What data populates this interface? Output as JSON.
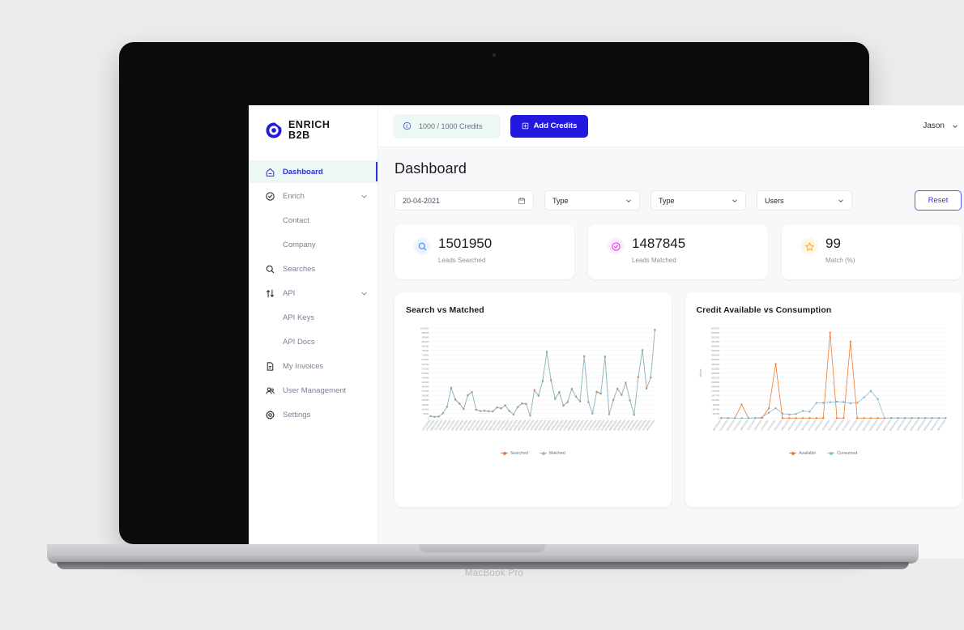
{
  "device": {
    "label": "MacBook Pro"
  },
  "brand": {
    "name_line1": "ENRICH",
    "name_line2": "B2B",
    "color": "#2218df"
  },
  "sidebar": {
    "items": [
      {
        "label": "Dashboard",
        "icon": "home-icon",
        "active": true,
        "has_caret": false,
        "sub": false
      },
      {
        "label": "Enrich",
        "icon": "check-circle-icon",
        "active": false,
        "has_caret": true,
        "sub": false
      },
      {
        "label": "Contact",
        "icon": "none",
        "active": false,
        "has_caret": false,
        "sub": true
      },
      {
        "label": "Company",
        "icon": "none",
        "active": false,
        "has_caret": false,
        "sub": true
      },
      {
        "label": "Searches",
        "icon": "search-icon",
        "active": false,
        "has_caret": false,
        "sub": false
      },
      {
        "label": "API",
        "icon": "transfer-icon",
        "active": false,
        "has_caret": true,
        "sub": false
      },
      {
        "label": "API Keys",
        "icon": "none",
        "active": false,
        "has_caret": false,
        "sub": true
      },
      {
        "label": "API Docs",
        "icon": "none",
        "active": false,
        "has_caret": false,
        "sub": true
      },
      {
        "label": "My Invoices",
        "icon": "invoice-icon",
        "active": false,
        "has_caret": false,
        "sub": false
      },
      {
        "label": "User Management",
        "icon": "users-icon",
        "active": false,
        "has_caret": false,
        "sub": false
      },
      {
        "label": "Settings",
        "icon": "gear-icon",
        "active": false,
        "has_caret": false,
        "sub": false
      }
    ]
  },
  "topbar": {
    "credits_text": "1000 / 1000 Credits",
    "credits_icon": "credit-coin-icon",
    "add_credits_label": "Add Credits",
    "add_credits_icon": "plus-square-icon",
    "user_name": "Jason",
    "user_caret_icon": "chevron-down-icon"
  },
  "page": {
    "title": "Dashboard"
  },
  "filters": {
    "date_value": "20-04-2021",
    "date_icon": "calendar-icon",
    "select1_value": "Type",
    "select2_value": "Type",
    "select3_value": "Users",
    "reset_label": "Reset"
  },
  "stats": [
    {
      "value": "1501950",
      "label": "Leads Searched",
      "icon": "search-icon",
      "accent": "#2f80ed"
    },
    {
      "value": "1487845",
      "label": "Leads Matched",
      "icon": "check-circle-icon",
      "accent": "#d93fd9"
    },
    {
      "value": "99",
      "label": "Match (%)",
      "icon": "star-icon",
      "accent": "#f0b429"
    }
  ],
  "chart_data": [
    {
      "type": "line",
      "title": "Search vs Matched",
      "xlabel": "",
      "ylabel": "",
      "ylim": [
        0,
        104000
      ],
      "grid": true,
      "legend_position": "bottom",
      "yticks": [
        104000,
        98800,
        93600,
        88400,
        83200,
        78000,
        72800,
        67600,
        62400,
        57200,
        52000,
        46800,
        41600,
        36400,
        31200,
        26000,
        20800,
        15600,
        10400,
        5200,
        0
      ],
      "categories": [
        "01/11/2022",
        "07/11/2022",
        "09/11/2022",
        "11/11/2022",
        "15/11/2022",
        "17/11/2022",
        "21/11/2022",
        "23/11/2022",
        "25/11/2022",
        "29/11/2022",
        "01/12/2022",
        "05/12/2022",
        "07/12/2022",
        "09/12/2022",
        "13/12/2022",
        "15/12/2022",
        "19/12/2022",
        "21/12/2022",
        "23/12/2022",
        "27/12/2022",
        "29/12/2022",
        "02/01/2023",
        "04/01/2023",
        "06/01/2023",
        "10/01/2023",
        "12/01/2023",
        "16/01/2023",
        "18/01/2023",
        "20/01/2023",
        "24/01/2023",
        "26/01/2023",
        "30/01/2023",
        "01/02/2023",
        "03/02/2023",
        "07/02/2023",
        "09/02/2023",
        "13/02/2023",
        "15/02/2023",
        "17/02/2023",
        "21/02/2023",
        "23/02/2023",
        "27/02/2023",
        "01/03/2023",
        "03/03/2023",
        "07/03/2023",
        "09/03/2023",
        "13/03/2023",
        "15/03/2023",
        "17/03/2023",
        "21/03/2023",
        "23/03/2023",
        "27/03/2023",
        "29/03/2023",
        "31/03/2023",
        "04/04/2023"
      ],
      "series": [
        {
          "name": "Searched",
          "color": "#f07c2b",
          "values": [
            2200,
            1500,
            1800,
            5600,
            13200,
            35000,
            21500,
            16800,
            10500,
            26500,
            30200,
            9800,
            8200,
            8500,
            7900,
            7800,
            12500,
            11200,
            14800,
            8300,
            4200,
            12800,
            17000,
            16500,
            3000,
            32500,
            26000,
            43000,
            76500,
            44000,
            22500,
            30000,
            14500,
            18500,
            33800,
            25000,
            19500,
            71500,
            18500,
            5400,
            30500,
            28500,
            71000,
            4500,
            21000,
            34000,
            27000,
            41000,
            20500,
            3800,
            47500,
            78500,
            34500,
            47000,
            102000
          ]
        },
        {
          "name": "Matched",
          "color": "#7dc4dd",
          "values": [
            2000,
            1400,
            1700,
            5400,
            12900,
            34500,
            21000,
            16400,
            10200,
            26000,
            29800,
            9500,
            8000,
            8300,
            7700,
            7600,
            12200,
            11000,
            14500,
            8100,
            4000,
            12500,
            16700,
            16200,
            2800,
            32000,
            25500,
            42500,
            76000,
            43500,
            22000,
            29500,
            14200,
            18200,
            33400,
            24600,
            19200,
            71000,
            18200,
            5200,
            30000,
            28000,
            70500,
            4300,
            20600,
            33600,
            26600,
            40500,
            20200,
            3600,
            47000,
            78000,
            34000,
            46500,
            101500
          ]
        }
      ]
    },
    {
      "type": "line",
      "title": "Credit Available vs Consumption",
      "xlabel": "",
      "ylabel": "Values",
      "ylim": [
        0,
        567000
      ],
      "grid": true,
      "legend_position": "bottom",
      "yticks": [
        567000,
        538650,
        510300,
        481950,
        453600,
        425250,
        396900,
        368550,
        340200,
        311850,
        283500,
        255150,
        226800,
        198450,
        170100,
        141750,
        113400,
        85050,
        56700,
        28350,
        0
      ],
      "categories": [
        "28/10/2022",
        "01/11/2022",
        "03/11/2022",
        "07/11/2022",
        "09/11/2022",
        "11/11/2022",
        "15/11/2022",
        "17/11/2022",
        "21/11/2022",
        "23/11/2022",
        "25/11/2022",
        "29/11/2022",
        "01/12/2022",
        "05/12/2022",
        "07/12/2022",
        "09/12/2022",
        "13/12/2022",
        "15/12/2022",
        "19/12/2022",
        "21/12/2022",
        "23/12/2022",
        "27/12/2022",
        "29/12/2022",
        "02/01/2023",
        "04/01/2023",
        "06/01/2023",
        "10/01/2023",
        "12/01/2023",
        "16/01/2023",
        "18/01/2023",
        "20/01/2023",
        "24/01/2023",
        "26/01/2023",
        "06/02/2023"
      ],
      "series": [
        {
          "name": "Available",
          "color": "#f07c2b",
          "values": [
            0,
            0,
            0,
            85000,
            0,
            0,
            0,
            62000,
            340000,
            0,
            0,
            0,
            0,
            0,
            0,
            0,
            538000,
            0,
            0,
            481000,
            0,
            0,
            0,
            0,
            0,
            0,
            0,
            0,
            0,
            0,
            0,
            0,
            0,
            0
          ]
        },
        {
          "name": "Consumed",
          "color": "#7dc4dd",
          "values": [
            0,
            0,
            0,
            0,
            0,
            0,
            5000,
            34000,
            62000,
            28000,
            22000,
            26000,
            45000,
            40000,
            95000,
            96000,
            100000,
            103000,
            101000,
            93000,
            96000,
            130000,
            170000,
            120000,
            0,
            0,
            0,
            0,
            0,
            0,
            0,
            0,
            0,
            0
          ]
        }
      ]
    }
  ],
  "chart_legends": [
    [
      {
        "label": "Searched",
        "color": "#f07c2b"
      },
      {
        "label": "Matched",
        "color": "#7dc4dd"
      }
    ],
    [
      {
        "label": "Available",
        "color": "#f07c2b"
      },
      {
        "label": "Consumed",
        "color": "#7dc4dd"
      }
    ]
  ]
}
